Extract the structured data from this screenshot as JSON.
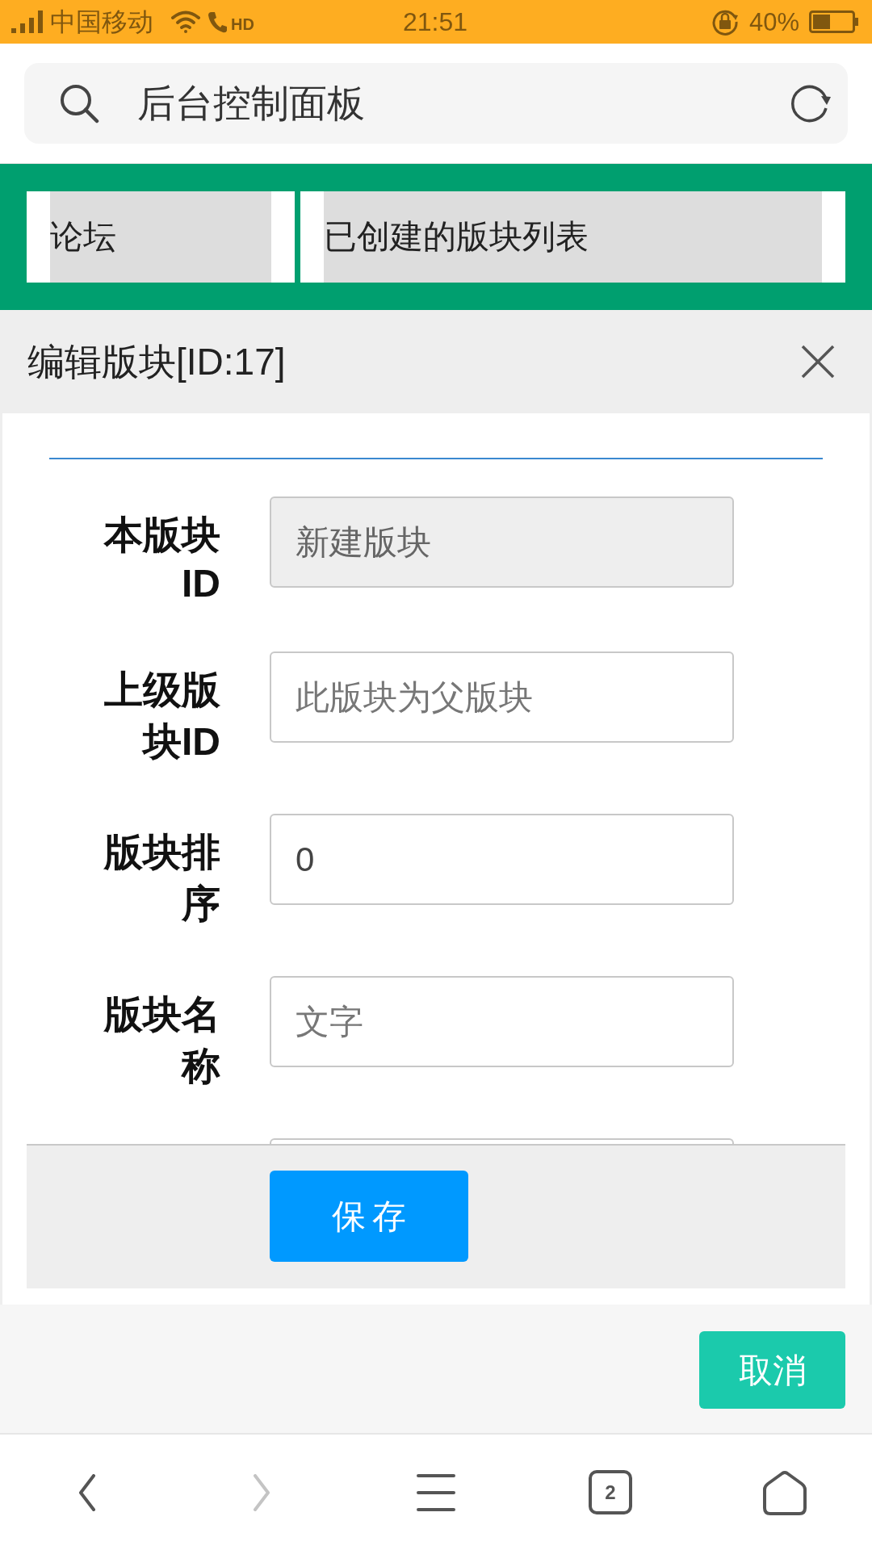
{
  "status_bar": {
    "carrier": "中国移动",
    "call_badge": "HD",
    "time": "21:51",
    "battery": "40%"
  },
  "address_bar": {
    "title": "后台控制面板"
  },
  "tabs": [
    {
      "label": "论坛"
    },
    {
      "label": "已创建的版块列表"
    }
  ],
  "modal": {
    "title": "编辑版块[ID:17]",
    "fields": [
      {
        "kind": "readonly",
        "label": "本版块ID",
        "value": "新建版块"
      },
      {
        "kind": "input",
        "label": "上级版块ID",
        "placeholder": "此版块为父版块"
      },
      {
        "kind": "input",
        "label": "版块排序",
        "value": "0"
      },
      {
        "kind": "input",
        "label": "版块名称",
        "placeholder": "文字"
      },
      {
        "kind": "cut"
      }
    ],
    "save_button": "保存"
  },
  "cancel_button": "取消",
  "bottom_nav": [
    {
      "kind": "back",
      "disabled": false
    },
    {
      "kind": "forward",
      "disabled": true
    },
    {
      "kind": "menu",
      "disabled": false
    },
    {
      "kind": "tabs",
      "count": "2",
      "disabled": false
    },
    {
      "kind": "home",
      "disabled": false
    }
  ]
}
